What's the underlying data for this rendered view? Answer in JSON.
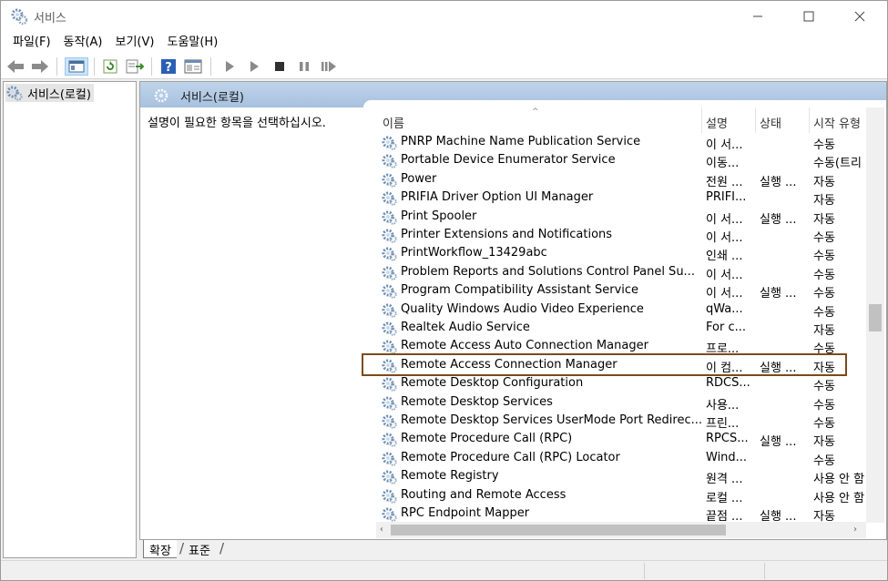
{
  "window": {
    "title": "서비스",
    "controls": {
      "minimize": "—",
      "maximize": "☐",
      "close": "✕"
    }
  },
  "menu": [
    "파일(F)",
    "동작(A)",
    "보기(V)",
    "도움말(H)"
  ],
  "tree": {
    "root_label": "서비스(로컬)"
  },
  "main": {
    "header_title": "서비스(로컬)",
    "description": "설명이 필요한 항목을 선택하십시오.",
    "columns": {
      "name": "이름",
      "description": "설명",
      "status": "상태",
      "startup": "시작 유형"
    },
    "sort_indicator": "^",
    "selected_row": "Remote Access Connection Manager",
    "rows": [
      {
        "name": "PNRP Machine Name Publication Service",
        "desc": "이 서...",
        "status": "",
        "startup": "수동"
      },
      {
        "name": "Portable Device Enumerator Service",
        "desc": "이동...",
        "status": "",
        "startup": "수동(트리"
      },
      {
        "name": "Power",
        "desc": "전원 ...",
        "status": "실행 ...",
        "startup": "자동"
      },
      {
        "name": "PRIFIA Driver Option UI Manager",
        "desc": "PRIFI...",
        "status": "",
        "startup": "자동"
      },
      {
        "name": "Print Spooler",
        "desc": "이 서...",
        "status": "실행 ...",
        "startup": "자동"
      },
      {
        "name": "Printer Extensions and Notifications",
        "desc": "이 서...",
        "status": "",
        "startup": "수동"
      },
      {
        "name": "PrintWorkflow_13429abc",
        "desc": "인쇄 ...",
        "status": "",
        "startup": "수동"
      },
      {
        "name": "Problem Reports and Solutions Control Panel Su...",
        "desc": "이 서...",
        "status": "",
        "startup": "수동"
      },
      {
        "name": "Program Compatibility Assistant Service",
        "desc": "이 서...",
        "status": "실행 ...",
        "startup": "수동"
      },
      {
        "name": "Quality Windows Audio Video Experience",
        "desc": "qWa...",
        "status": "",
        "startup": "수동"
      },
      {
        "name": "Realtek Audio Service",
        "desc": "For c...",
        "status": "",
        "startup": "자동"
      },
      {
        "name": "Remote Access Auto Connection Manager",
        "desc": "프로...",
        "status": "",
        "startup": "수동"
      },
      {
        "name": "Remote Access Connection Manager",
        "desc": "이 컴...",
        "status": "실행 ...",
        "startup": "자동"
      },
      {
        "name": "Remote Desktop Configuration",
        "desc": "RDCS...",
        "status": "",
        "startup": "수동"
      },
      {
        "name": "Remote Desktop Services",
        "desc": "사용...",
        "status": "",
        "startup": "수동"
      },
      {
        "name": "Remote Desktop Services UserMode Port Redirec...",
        "desc": "프린...",
        "status": "",
        "startup": "수동"
      },
      {
        "name": "Remote Procedure Call (RPC)",
        "desc": "RPCS...",
        "status": "실행 ...",
        "startup": "자동"
      },
      {
        "name": "Remote Procedure Call (RPC) Locator",
        "desc": "Wind...",
        "status": "",
        "startup": "수동"
      },
      {
        "name": "Remote Registry",
        "desc": "원격 ...",
        "status": "",
        "startup": "사용 안 함"
      },
      {
        "name": "Routing and Remote Access",
        "desc": "로컬 ...",
        "status": "",
        "startup": "사용 안 함"
      },
      {
        "name": "RPC Endpoint Mapper",
        "desc": "끝점 ...",
        "status": "실행 ...",
        "startup": "자동"
      }
    ]
  },
  "tabs": {
    "extended": "확장",
    "standard": "표준"
  },
  "colors": {
    "highlight_border": "#7d4a1b",
    "header_gradient_top": "#bfd4ea",
    "header_gradient_bottom": "#a7c1df"
  },
  "icons": [
    "services-gear-icon",
    "back-arrow-icon",
    "forward-arrow-icon",
    "console-tree-icon",
    "refresh-icon",
    "export-list-icon",
    "help-icon",
    "properties-icon",
    "start-icon",
    "start-alt-icon",
    "stop-icon",
    "pause-icon",
    "restart-icon"
  ]
}
